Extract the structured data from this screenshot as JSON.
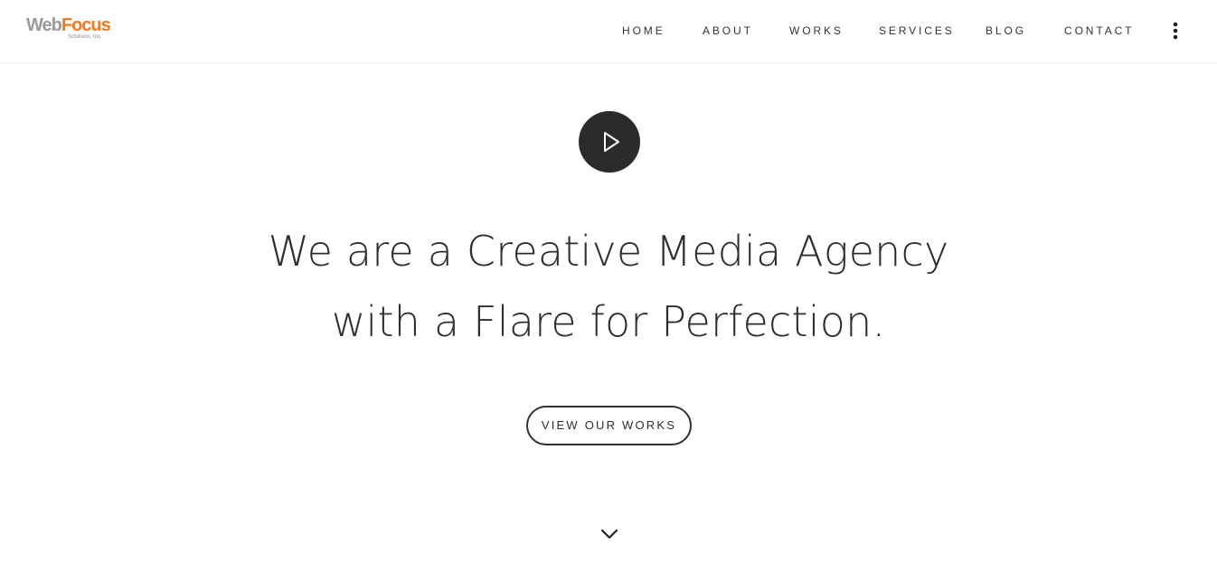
{
  "brand": {
    "logo_main_web": "Web",
    "logo_main_focus": "Focus",
    "logo_sub": "Solutions, Inc.",
    "web_color": "#9a9a9a",
    "focus_color": "#f07820"
  },
  "nav": {
    "items": [
      {
        "label": "HOME"
      },
      {
        "label": "ABOUT"
      },
      {
        "label": "WORKS"
      },
      {
        "label": "SERVICES"
      },
      {
        "label": "BLOG"
      },
      {
        "label": "CONTACT"
      }
    ],
    "more_icon": "kebab-menu-icon"
  },
  "hero": {
    "play_icon": "play-icon",
    "headline_line1": "We are a Creative Media Agency",
    "headline_line2": "with a Flare for Perfection.",
    "cta_label": "VIEW OUR WORKS",
    "scroll_icon": "chevron-down-icon"
  },
  "colors": {
    "text": "#333333",
    "play_button_bg": "#2b2b2b",
    "background": "#ffffff"
  }
}
